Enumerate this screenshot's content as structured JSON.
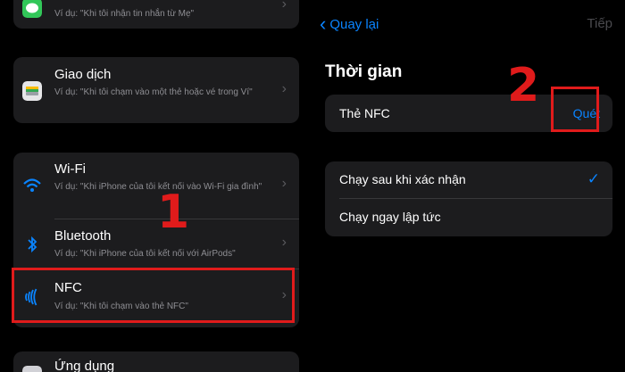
{
  "left_list": {
    "messages_row": {
      "subtitle": "Ví dụ: \"Khi tôi nhận tin nhắn từ Mẹ\""
    },
    "wallet_row": {
      "title": "Giao dịch",
      "subtitle": "Ví dụ: \"Khi tôi chạm vào một thẻ hoặc vé trong Ví\""
    },
    "wifi_row": {
      "title": "Wi-Fi",
      "subtitle": "Ví dụ: \"Khi iPhone của tôi kết nối vào Wi-Fi gia đình\""
    },
    "bluetooth_row": {
      "title": "Bluetooth",
      "subtitle": "Ví dụ: \"Khi iPhone của tôi kết nối với AirPods\""
    },
    "nfc_row": {
      "title": "NFC",
      "subtitle": "Ví dụ: \"Khi tôi chạm vào thẻ NFC\""
    },
    "apps_row": {
      "title": "Ứng dụng"
    }
  },
  "right_panel": {
    "back_label": "Quay lại",
    "next_label": "Tiếp",
    "section_title": "Thời gian",
    "nfc_tag_label": "Thẻ NFC",
    "scan_label": "Quét",
    "options": [
      "Chạy sau khi xác nhận",
      "Chạy ngay lập tức"
    ],
    "selected_option": "Chạy sau khi xác nhận"
  },
  "annotations": {
    "step1": "1",
    "step2": "2"
  },
  "colors": {
    "accent": "#0a84ff",
    "highlight": "#e01b1b",
    "card": "#1c1c1e"
  }
}
